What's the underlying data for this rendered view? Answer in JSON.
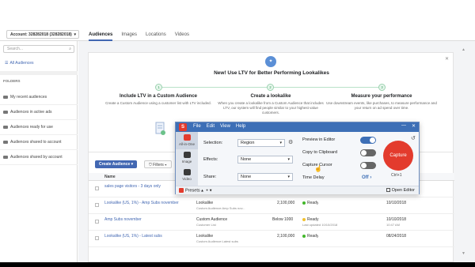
{
  "account": {
    "label": "Account: 328282018 (328282018)"
  },
  "nav_tabs": [
    "Audiences",
    "Images",
    "Locations",
    "Videos"
  ],
  "sidebar": {
    "search_placeholder": "Search...",
    "all_audiences": "All Audiences",
    "folders_heading": "FOLDERS",
    "folders": [
      "My recent audiences",
      "Audiences in active ads",
      "Audiences ready for use",
      "Audiences shared to account",
      "Audiences shared by account"
    ]
  },
  "promo": {
    "title": "New! Use LTV for Better Performing Lookalikes",
    "steps": [
      {
        "num": "1",
        "title": "Include LTV in a Custom Audience",
        "desc": "Create a Custom Audience using a customer list with LTV included."
      },
      {
        "num": "2",
        "title": "Create a lookalike",
        "desc": "When you create a lookalike from a Custom Audience that includes LTV, our system will find people similar to your highest value customers."
      },
      {
        "num": "3",
        "title": "Measure your performance",
        "desc": "Use downstream events, like purchases, to measure performance and your return on ad spend over time."
      }
    ]
  },
  "table": {
    "create_button": "Create Audience",
    "filters_button": "Filters",
    "columns": [
      "Name"
    ],
    "rows": [
      {
        "name": "sales page visitors - 3 days only",
        "type": "",
        "type_sub": "",
        "size": "",
        "status": "",
        "status_sub": "",
        "date": "",
        "date_sub": ""
      },
      {
        "name": "Lookalike (US, 1%) - Amp Subs november",
        "type": "Lookalike",
        "type_sub": "Custom Audience:Amp Subs nov...",
        "size": "2,100,000",
        "status": "Ready",
        "status_sub": "",
        "date": "10/10/2018",
        "date_sub": ""
      },
      {
        "name": "Amp Subs november",
        "type": "Custom Audience",
        "type_sub": "Customer List",
        "size": "Below 1000",
        "status": "Ready",
        "status_sub": "Last updated 10/10/2018",
        "date": "10/10/2018",
        "date_sub": "10:47 AM"
      },
      {
        "name": "Lookalike (US, 1%) - Latest subs",
        "type": "Lookalike",
        "type_sub": "Custom Audience:Latest subs",
        "size": "2,100,000",
        "status": "Ready",
        "status_sub": "",
        "date": "08/24/2018",
        "date_sub": ""
      }
    ]
  },
  "capture_window": {
    "menu": [
      "File",
      "Edit",
      "View",
      "Help"
    ],
    "modes": [
      {
        "label": "All-in-One"
      },
      {
        "label": "Image"
      },
      {
        "label": "Video"
      }
    ],
    "selection_label": "Selection:",
    "selection_value": "Region",
    "effects_label": "Effects:",
    "effects_value": "None",
    "share_label": "Share:",
    "share_value": "None",
    "options": [
      {
        "label": "Preview in Editor",
        "on": true
      },
      {
        "label": "Copy to Clipboard",
        "on": false
      },
      {
        "label": "Capture Cursor",
        "on": false
      },
      {
        "label": "Time Delay",
        "on": false
      }
    ],
    "time_delay_value": "Off",
    "capture_button": "Capture",
    "shortcut": "Ctrl+1",
    "presets": "Presets",
    "open_editor": "Open Editor"
  }
}
